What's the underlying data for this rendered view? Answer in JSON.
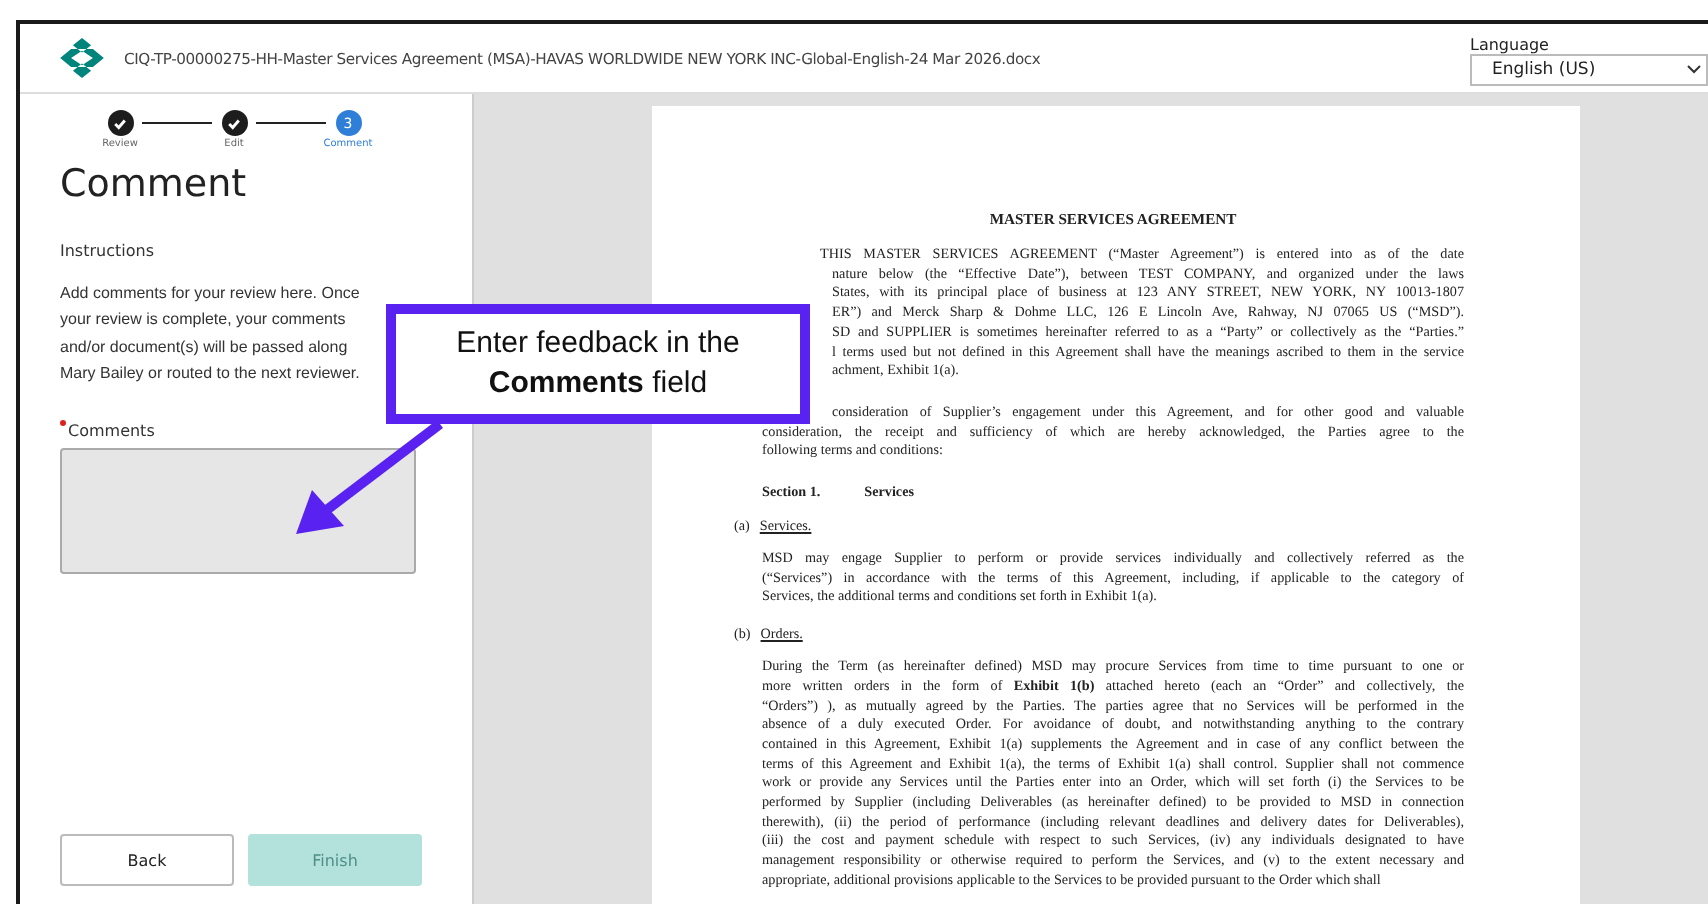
{
  "header": {
    "title": "CIQ-TP-00000275-HH-Master Services Agreement (MSA)-HAVAS WORLDWIDE NEW YORK INC-Global-English-24 Mar 2026.docx",
    "language": {
      "label": "Language",
      "value": "English (US)"
    }
  },
  "steps": [
    {
      "label": "Review",
      "completed": true,
      "selected": false
    },
    {
      "label": "Edit",
      "completed": true,
      "selected": false
    },
    {
      "label": "Comment",
      "completed": false,
      "selected": true,
      "number": "3"
    }
  ],
  "panel": {
    "heading": "Comment",
    "instructions_label": "Instructions",
    "instructions": "Add comments for your review here. Once your review is complete, your comments and/or document(s) will be passed along Mary Bailey or routed to the next reviewer.",
    "comments": {
      "label": "Comments",
      "required": true
    },
    "buttons": [
      {
        "label": "Back",
        "disabled": false
      },
      {
        "label": "Finish",
        "disabled": true
      }
    ]
  },
  "callout": {
    "text": "Enter feedback in the **Comments** field"
  },
  "document": {
    "blocks": [
      {
        "kind": "title",
        "text": "MASTER SERVICES AGREEMENT"
      },
      {
        "kind": "paragraph",
        "lines": [
          {
            "text": "THIS MASTER SERVICES AGREEMENT  (“Master Agreement”) is entered into as of the date",
            "cut": false
          },
          {
            "text": "nature below (the “Effective Date”), between TEST COMPANY, and organized under the laws",
            "cut": true
          },
          {
            "text": "States, with its principal place of business at 123 ANY STREET, NEW YORK, NY 10013-1807",
            "cut": true
          },
          {
            "text": "ER”) and Merck Sharp & Dohme LLC, 126 E Lincoln Ave, Rahway, NJ 07065 US (“MSD”).",
            "cut": true
          },
          {
            "text": "SD and SUPPLIER is sometimes hereinafter referred to as a “Party” or collectively as the “Parties.”",
            "cut": true
          },
          {
            "text": "l terms used but not defined in this Agreement shall have the meanings ascribed to them in the service",
            "cut": true
          },
          {
            "text": "achment, Exhibit 1(a).",
            "cut": true
          }
        ]
      },
      {
        "kind": "paragraph",
        "lines": [
          {
            "text": "consideration of Supplier’s engagement under this Agreement, and for other good and valuable",
            "cut": true
          },
          {
            "text": "consideration, the receipt and sufficiency of which are hereby acknowledged, the Parties agree to the",
            "cut": false
          },
          {
            "text": "following terms and conditions:",
            "cut": false
          }
        ]
      },
      {
        "kind": "section",
        "number": "Section 1.",
        "text": "Services"
      },
      {
        "kind": "item",
        "marker": "(a)",
        "text": "Services."
      },
      {
        "kind": "body",
        "lines": [
          "MSD may engage Supplier to perform or provide services individually and collectively referred as the",
          "(“Services”) in accordance with the terms of this Agreement, including, if applicable to the category of",
          "Services, the additional terms and conditions set forth in Exhibit 1(a)."
        ]
      },
      {
        "kind": "item",
        "marker": "(b)",
        "text": "Orders."
      },
      {
        "kind": "body",
        "lines": [
          "During the Term (as hereinafter defined) MSD may procure Services from time to time pursuant to one or",
          "more written orders in the form of **Exhibit 1(b)** attached hereto (each an “Order” and collectively, the",
          "“Orders”) ), as mutually agreed by the Parties.  The parties agree that no Services will be performed in the",
          "absence of a duly executed Order.  For avoidance of doubt,  and notwithstanding anything to the contrary",
          "contained in this Agreement, Exhibit 1(a) supplements the Agreement and in case of any conflict between the",
          "terms of this Agreement and Exhibit 1(a), the terms of Exhibit 1(a) shall control. Supplier shall not commence",
          "work or provide any Services until the Parties enter into an Order, which will set forth (i) the Services to be",
          "performed by Supplier (including Deliverables (as hereinafter defined) to be provided to MSD in connection",
          "therewith), (ii) the period of performance (including relevant deadlines and delivery dates for Deliverables),",
          "(iii) the cost and payment schedule with respect to such Services, (iv) any individuals designated to have",
          "management responsibility or otherwise required to perform the Services, and (v) to the extent necessary and",
          "appropriate, additional provisions applicable to the Services to be provided pursuant to the Order which shall"
        ]
      }
    ]
  }
}
